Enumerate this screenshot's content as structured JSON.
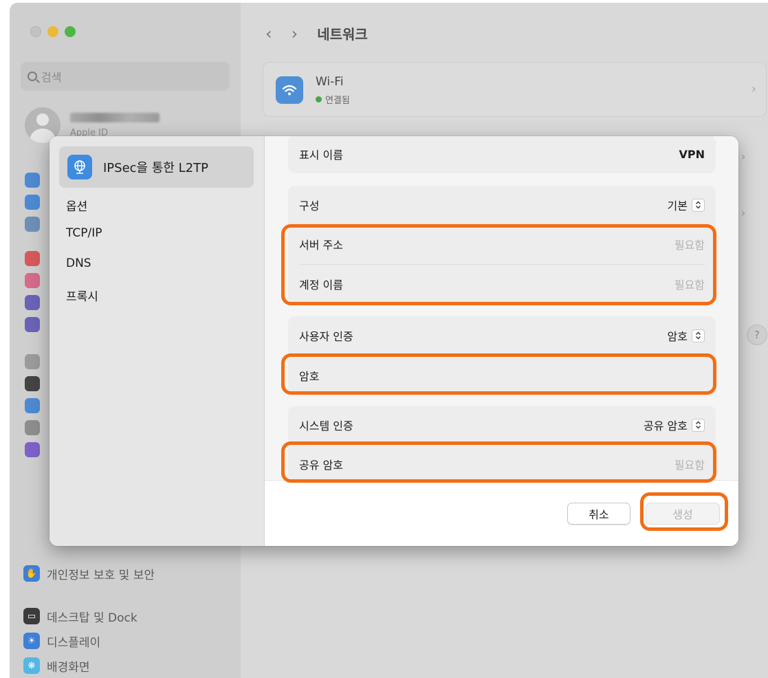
{
  "window": {
    "title": "네트워크",
    "search_placeholder": "검색",
    "account_subtitle": "Apple ID"
  },
  "network": {
    "wifi_name": "Wi-Fi",
    "wifi_status": "연결됨"
  },
  "background_sidebar": {
    "privacy": "개인정보 보호 및 보안",
    "desktop_dock": "데스크탑 및 Dock",
    "displays": "디스플레이",
    "wallpaper": "배경화면"
  },
  "dialog": {
    "sidebar": {
      "selected": "IPSec을 통한 L2TP",
      "items": [
        "옵션",
        "TCP/IP",
        "DNS",
        "프록시"
      ]
    },
    "display_name": {
      "label": "표시 이름",
      "value": "VPN"
    },
    "configuration": {
      "label": "구성",
      "value": "기본"
    },
    "server_address": {
      "label": "서버 주소",
      "placeholder": "필요함"
    },
    "account_name": {
      "label": "계정 이름",
      "placeholder": "필요함"
    },
    "user_auth": {
      "label": "사용자 인증",
      "value": "암호"
    },
    "password": {
      "label": "암호"
    },
    "machine_auth": {
      "label": "시스템 인증",
      "value": "공유 암호"
    },
    "shared_secret": {
      "label": "공유 암호",
      "placeholder": "필요함"
    },
    "buttons": {
      "cancel": "취소",
      "create": "생성"
    }
  },
  "colors": {
    "highlight": "#f36d14",
    "accent_blue": "#3f8be0",
    "status_green": "#44a845"
  }
}
